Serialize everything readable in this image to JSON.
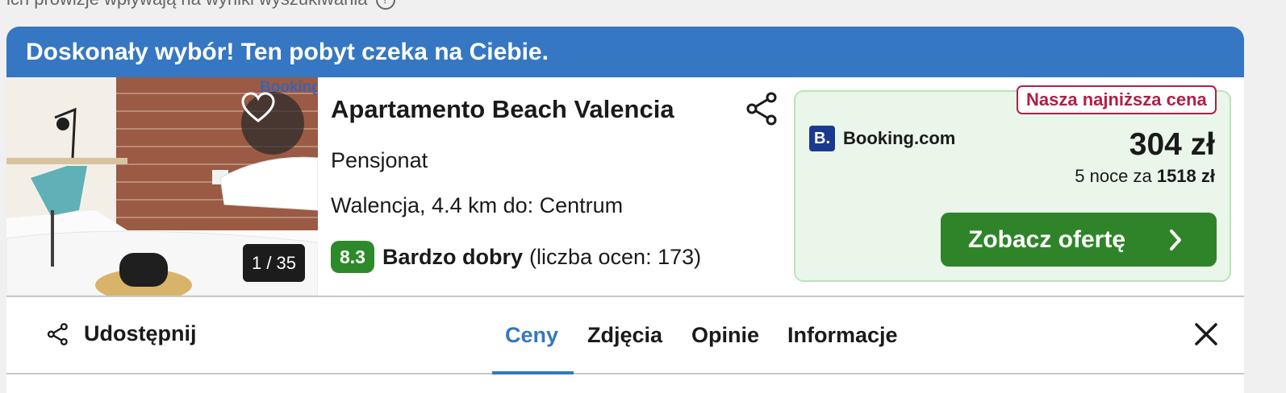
{
  "top_hint": {
    "text": "ich prowizje wpływają na wyniki wyszukiwania"
  },
  "banner": {
    "text": "Doskonały wybór! Ten pobyt czeka na Ciebie."
  },
  "photo": {
    "counter": "1 / 35",
    "watermark": "Booking"
  },
  "hotel": {
    "name": "Apartamento Beach Valencia",
    "type": "Pensjonat",
    "location": "Walencja, 4.4 km do: Centrum",
    "score": "8.3",
    "rating_word": "Bardzo dobry",
    "review_count": "(liczba ocen: 173)"
  },
  "offer": {
    "badge": "Nasza najniższa cena",
    "provider_logo_letter": "B.",
    "provider_name": "Booking.com",
    "price_per_night": "304 zł",
    "total_prefix": "5 noce za",
    "total_price": "1518 zł",
    "cta_label": "Zobacz ofertę"
  },
  "tabs": {
    "share_label": "Udostępnij",
    "items": [
      {
        "label": "Ceny",
        "active": true
      },
      {
        "label": "Zdjęcia",
        "active": false
      },
      {
        "label": "Opinie",
        "active": false
      },
      {
        "label": "Informacje",
        "active": false
      }
    ]
  },
  "colors": {
    "brand_blue": "#3577c2",
    "score_green": "#2d8a2a",
    "cta_green": "#2f8429",
    "badge_red": "#b02044",
    "price_box_bg": "#e9f6e9"
  },
  "icons": [
    "info-icon",
    "heart-icon",
    "share-icon",
    "booking-logo-icon",
    "chevron-right-icon",
    "close-icon"
  ]
}
